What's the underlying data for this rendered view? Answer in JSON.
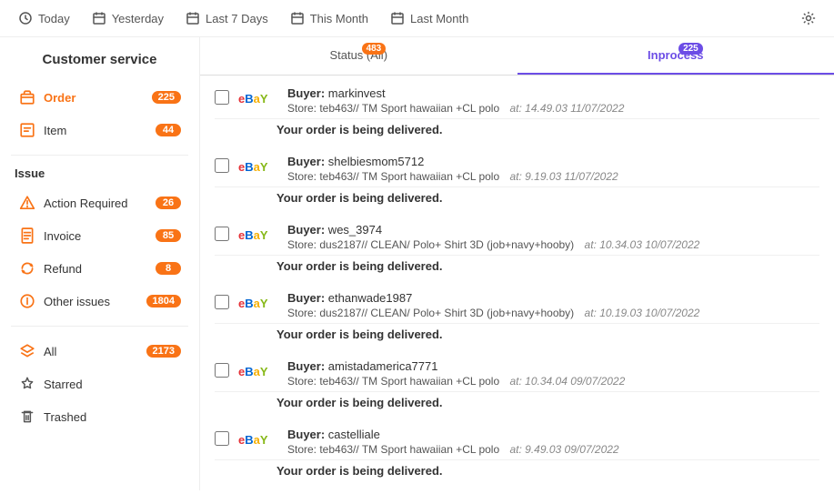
{
  "topbar": {
    "items": [
      {
        "label": "Today",
        "icon": "clock"
      },
      {
        "label": "Yesterday",
        "icon": "calendar"
      },
      {
        "label": "Last 7 Days",
        "icon": "calendar"
      },
      {
        "label": "This Month",
        "icon": "calendar"
      },
      {
        "label": "Last Month",
        "icon": "calendar"
      }
    ]
  },
  "sidebar": {
    "title": "Customer service",
    "orderSection": {
      "items": [
        {
          "label": "Order",
          "badge": "225",
          "icon": "box"
        },
        {
          "label": "Item",
          "badge": "44",
          "icon": "item"
        }
      ]
    },
    "issueSection": {
      "label": "Issue",
      "items": [
        {
          "label": "Action Required",
          "badge": "26",
          "icon": "warning"
        },
        {
          "label": "Invoice",
          "badge": "85",
          "icon": "invoice"
        },
        {
          "label": "Refund",
          "badge": "8",
          "icon": "refund"
        },
        {
          "label": "Other issues",
          "badge": "1804",
          "icon": "circle-info"
        }
      ]
    },
    "otherSection": {
      "items": [
        {
          "label": "All",
          "badge": "2173",
          "icon": "layers"
        },
        {
          "label": "Starred",
          "badge": "",
          "icon": "star"
        },
        {
          "label": "Trashed",
          "badge": "",
          "icon": "trash"
        }
      ]
    }
  },
  "tabs": [
    {
      "label": "Status (All)",
      "badge": "483",
      "active": false
    },
    {
      "label": "Inprocess",
      "badge": "225",
      "active": true
    }
  ],
  "orders": [
    {
      "buyer": "markinvest",
      "store": "teb463// TM Sport hawaiian +CL polo",
      "time": "at: 14.49.03 11/07/2022",
      "status": "Your order is being delivered."
    },
    {
      "buyer": "shelbiesmom5712",
      "store": "teb463// TM Sport hawaiian +CL polo",
      "time": "at: 9.19.03 11/07/2022",
      "status": "Your order is being delivered."
    },
    {
      "buyer": "wes_3974",
      "store": "dus2187// CLEAN/ Polo+ Shirt 3D (job+navy+hooby)",
      "time": "at: 10.34.03 10/07/2022",
      "status": "Your order is being delivered."
    },
    {
      "buyer": "ethanwade1987",
      "store": "dus2187// CLEAN/ Polo+ Shirt 3D (job+navy+hooby)",
      "time": "at: 10.19.03 10/07/2022",
      "status": "Your order is being delivered."
    },
    {
      "buyer": "amistadamerica7771",
      "store": "teb463// TM Sport hawaiian +CL polo",
      "time": "at: 10.34.04 09/07/2022",
      "status": "Your order is being delivered."
    },
    {
      "buyer": "castelliale",
      "store": "teb463// TM Sport hawaiian +CL polo",
      "time": "at: 9.49.03 09/07/2022",
      "status": "Your order is being delivered."
    }
  ],
  "ebay": {
    "colors": {
      "e": "#e53238",
      "b1": "#0064d2",
      "a": "#f5af02",
      "y": "#86b817"
    }
  }
}
